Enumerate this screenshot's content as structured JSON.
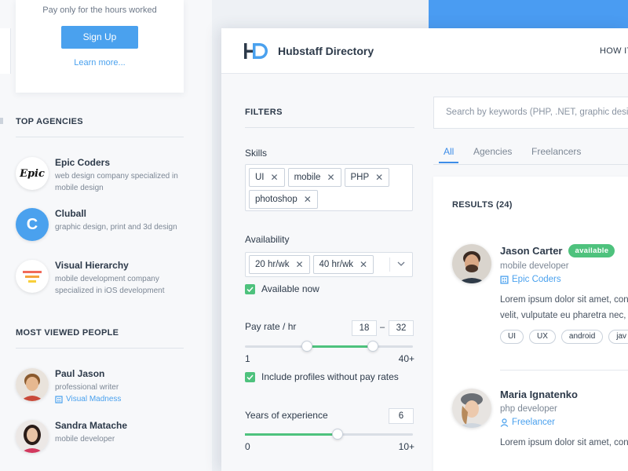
{
  "signup": {
    "note": "Pay only for the hours worked",
    "button": "Sign Up",
    "learn_more": "Learn more..."
  },
  "top_agencies": {
    "heading": "TOP AGENCIES",
    "items": [
      {
        "name": "Epic Coders",
        "desc": "web design company specialized in mobile design",
        "logo_text": "Epic"
      },
      {
        "name": "Cluball",
        "desc": "graphic design, print and 3d design",
        "logo_text": "C"
      },
      {
        "name": "Visual Hierarchy",
        "desc": "mobile development company specialized in iOS development"
      }
    ]
  },
  "most_viewed": {
    "heading": "MOST VIEWED PEOPLE",
    "items": [
      {
        "name": "Paul Jason",
        "role": "professional writer",
        "link": "Visual Madness"
      },
      {
        "name": "Sandra Matache",
        "role": "mobile developer"
      }
    ]
  },
  "header": {
    "brand": "Hubstaff Directory",
    "nav_item": "HOW IT"
  },
  "filters": {
    "title": "FILTERS",
    "skills_label": "Skills",
    "skills": [
      "UI",
      "mobile",
      "PHP",
      "photoshop"
    ],
    "availability_label": "Availability",
    "availability": [
      "20 hr/wk",
      "40 hr/wk"
    ],
    "available_now": "Available now",
    "pay_rate_label": "Pay rate / hr",
    "pay_min": "18",
    "pay_max": "32",
    "pay_scale_min": "1",
    "pay_scale_max": "40+",
    "pay_range_fraction": [
      0.37,
      0.76
    ],
    "include_no_rate": "Include profiles without pay rates",
    "experience_label": "Years of experience",
    "experience_value": "6",
    "exp_scale_min": "0",
    "exp_scale_max": "10+",
    "exp_fraction": 0.55
  },
  "search": {
    "placeholder": "Search by keywords (PHP, .NET, graphic design"
  },
  "tabs": [
    "All",
    "Agencies",
    "Freelancers"
  ],
  "results": {
    "title": "RESULTS (24)",
    "people": [
      {
        "name": "Jason Carter",
        "badge": "available",
        "role": "mobile developer",
        "link": "Epic Coders",
        "lorem1": "Lorem ipsum dolor sit amet, con",
        "lorem2": "velit, vulputate eu pharetra nec, n",
        "skills": [
          "UI",
          "UX",
          "android",
          "jav"
        ]
      },
      {
        "name": "Maria Ignatenko",
        "role": "php developer",
        "link": "Freelancer",
        "lorem1": "Lorem ipsum dolor sit amet, con"
      }
    ]
  },
  "colors": {
    "accent_blue": "#4aa1ee",
    "success_green": "#4ec27d",
    "text_dark": "#2d3a4a"
  }
}
